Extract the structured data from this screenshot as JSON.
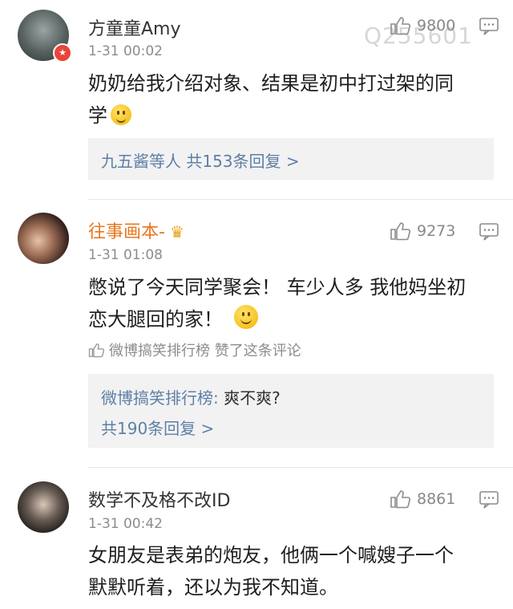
{
  "watermark": "Q255601",
  "comments": [
    {
      "author": "方童童Amy",
      "time": "1-31 00:02",
      "likes": "9800",
      "text_line1": "奶奶给我介绍对象、结果是初中打过架的同",
      "text_line2": "学",
      "emoji": "shrug-emoji",
      "reply_summary": "九五酱等人  共153条回复 >"
    },
    {
      "author": "往事画本-",
      "time": "1-31 01:08",
      "likes": "9273",
      "text_line1": "憋说了今天同学聚会！ 车少人多 我他妈坐初",
      "text_line2": "恋大腿回的家！",
      "emoji": "smile-emoji",
      "liked_by": "微博搞笑排行榜 赞了这条评论",
      "reply_author": "微博搞笑排行榜:",
      "reply_text": " 爽不爽?",
      "reply_count": "共190条回复 >"
    },
    {
      "author": "数学不及格不改ID",
      "time": "1-31 00:42",
      "likes": "8861",
      "text_line1": "女朋友是表弟的炮友，他俩一个喊嫂子一个",
      "text_line2": "默默听着，还以为我不知道。"
    }
  ],
  "icons": {
    "like": "thumbs-up-icon",
    "more": "comment-options-icon",
    "verified": "verified-badge-icon",
    "crown": "vip-crown-icon"
  },
  "colors": {
    "link": "#5d7fa6",
    "vip_name": "#e8761f",
    "meta": "#8c8c8c",
    "reply_bg": "#f2f2f2"
  }
}
